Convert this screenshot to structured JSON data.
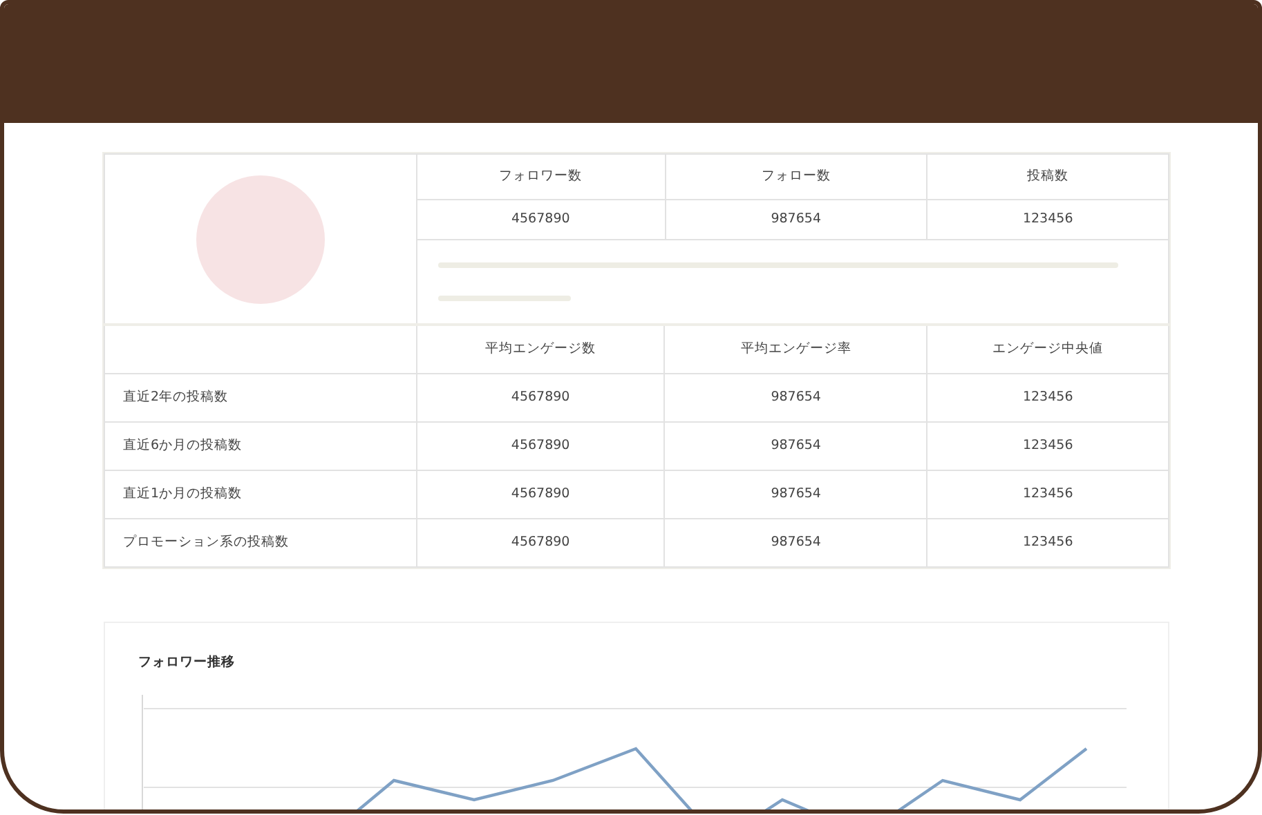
{
  "profile_stats": {
    "columns": [
      "フォロワー数",
      "フォロー数",
      "投稿数"
    ],
    "values": [
      "4567890",
      "987654",
      "123456"
    ]
  },
  "engagement_table": {
    "columns": [
      "平均エンゲージ数",
      "平均エンゲージ率",
      "エンゲージ中央値"
    ],
    "rows": [
      {
        "label": "直近2年の投稿数",
        "values": [
          "4567890",
          "987654",
          "123456"
        ]
      },
      {
        "label": "直近6か月の投稿数",
        "values": [
          "4567890",
          "987654",
          "123456"
        ]
      },
      {
        "label": "直近1か月の投稿数",
        "values": [
          "4567890",
          "987654",
          "123456"
        ]
      },
      {
        "label": "プロモーション系の投稿数",
        "values": [
          "4567890",
          "987654",
          "123456"
        ]
      }
    ]
  },
  "chart": {
    "title": "フォロワー推移"
  }
}
